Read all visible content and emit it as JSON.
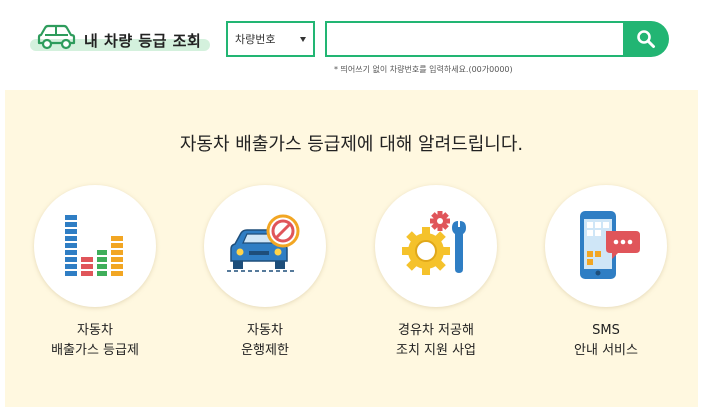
{
  "header": {
    "logo_text": "내 차량 등급 조회",
    "search_type": {
      "selected": "차량번호"
    },
    "search_input": {
      "value": "",
      "placeholder": ""
    },
    "hint": "* 띄어쓰기 없이 차량번호를 입력하세요.(00가0000)"
  },
  "info": {
    "title": "자동차 배출가스 등급제에 대해 알려드립니다.",
    "services": [
      {
        "icon": "bar-chart-icon",
        "line1": "자동차",
        "line2": "배출가스 등급제"
      },
      {
        "icon": "car-restriction-icon",
        "line1": "자동차",
        "line2": "운행제한"
      },
      {
        "icon": "gear-wrench-icon",
        "line1": "경유차 저공해",
        "line2": "조치 지원 사업"
      },
      {
        "icon": "phone-message-icon",
        "line1": "SMS",
        "line2": "안내 서비스"
      }
    ]
  },
  "colors": {
    "accent": "#22b573",
    "panel_bg": "#fff8e0",
    "logo_highlight": "#d4f1dd"
  }
}
